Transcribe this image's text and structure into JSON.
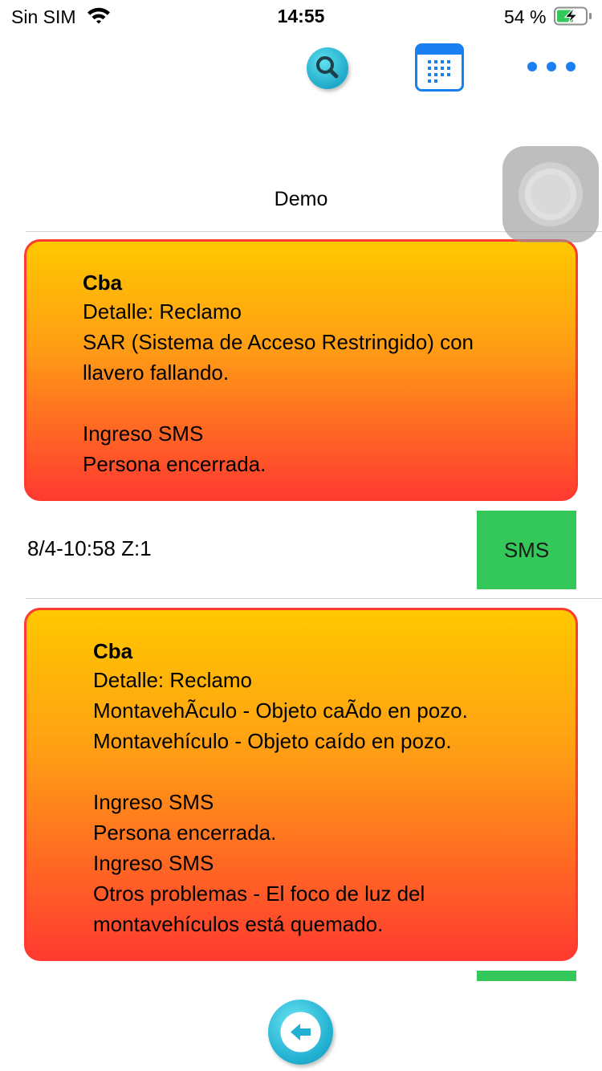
{
  "status_bar": {
    "carrier": "Sin SIM",
    "time": "14:55",
    "battery_percent": "54 %",
    "battery_level": 0.54,
    "charging": true
  },
  "toolbar": {
    "search_icon": "search-icon",
    "calendar_icon": "calendar-icon",
    "more_icon": "more-dots-icon",
    "accent_color": "#1a7ff0"
  },
  "page": {
    "title": "Demo"
  },
  "cards": [
    {
      "title": "Cba",
      "lines": [
        "Detalle: Reclamo",
        "SAR (Sistema de Acceso Restringido) con",
        "llavero fallando.",
        "",
        "Ingreso SMS",
        "Persona encerrada."
      ]
    },
    {
      "title": "Cba",
      "lines": [
        "Detalle: Reclamo",
        "MontavehÃculo - Objeto caÃdo en pozo.",
        "Montavehículo - Objeto caído en pozo.",
        "",
        "Ingreso SMS",
        "Persona encerrada.",
        "Ingreso SMS",
        "Otros problemas - El foco de luz del",
        "montavehículos está quemado."
      ]
    }
  ],
  "entry": {
    "meta": "8/4-10:58 Z:1",
    "sms_label": "SMS"
  },
  "colors": {
    "card_top": "#ffc800",
    "card_bottom": "#ff3b30",
    "sms_green": "#34c759"
  },
  "footer": {
    "back_icon": "back-arrow-icon"
  }
}
